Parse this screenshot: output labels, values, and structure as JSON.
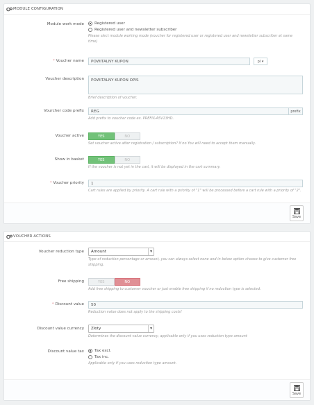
{
  "module_config": {
    "heading": "MODULE CONFIGURATION",
    "work_mode": {
      "label": "Module work mode",
      "options": [
        "Registered user",
        "Registered user and newsletter subscriber"
      ],
      "selected": "Registered user",
      "help": "Please slect module working mode (voucher for registered user or registered user and newsletter subscriber at same time)"
    },
    "voucher_name": {
      "label": "Voucher name",
      "value": "POWITALNY KUPON",
      "lang": "pl"
    },
    "voucher_description": {
      "label": "Voucher description",
      "value": "POWITALNY KUPON OPIS",
      "help": "Brief description of voucher."
    },
    "code_prefix": {
      "label": "Vourcher code prefix",
      "value": "REG",
      "addon": "prefix",
      "help": "Add prefix to voucher code ex. PREFIX-A5V13HD."
    },
    "voucher_active": {
      "label": "Voucher active",
      "yes": "YES",
      "no": "NO",
      "value": "YES",
      "help": "Set voucher active after registration / subscription? If no You will need to accept them manually."
    },
    "show_in_basket": {
      "label": "Show in basket",
      "yes": "YES",
      "no": "NO",
      "value": "YES",
      "help": "If the voucher is not yet in the cart, it will be displayed in the cart summary."
    },
    "voucher_priority": {
      "label": "Voucher priority",
      "value": "1",
      "help": "Cart rules are applied by priority. A cart rule with a priority of \"1\" will be processed before a cart rule with a priority of \"2\"."
    },
    "save_label": "Save"
  },
  "voucher_actions": {
    "heading": "VOUCHER ACTIONS",
    "reduction_type": {
      "label": "Voucher reduction type",
      "value": "Amount",
      "help": "Type of reduction percentage or amount, you can always select none and in below option choose to give customer free shipping."
    },
    "free_shipping": {
      "label": "Free shipping",
      "yes": "YES",
      "no": "NO",
      "value": "NO",
      "help": "Add free shipping to customer voucher or just enable free shipping if no reduction type is selected."
    },
    "discount_value": {
      "label": "Discount value",
      "value": "50",
      "help": "Reduction value does not apply to the shipping costs!"
    },
    "discount_currency": {
      "label": "Discount value currency",
      "value": "Złoty",
      "help": "Determines the discount value currency, applicable only if you uses reduction type amount"
    },
    "discount_tax": {
      "label": "Discount value tax",
      "options": [
        "Tax excl.",
        "Tax inc."
      ],
      "selected": "Tax excl.",
      "help": "Applicable only if you uses reduction type amount."
    },
    "save_label": "Save"
  },
  "colors": {
    "yes_active": "#72c279",
    "no_active": "#e08f95",
    "required": "#e08f95"
  }
}
